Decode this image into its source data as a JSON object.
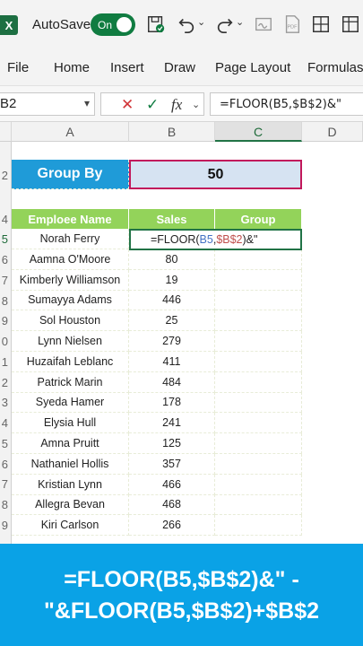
{
  "titlebar": {
    "app_icon": "X",
    "autosave_label": "AutoSave",
    "toggle_label": "On",
    "icons": [
      "save-icon",
      "undo-icon",
      "redo-icon",
      "sign-icon",
      "pdf-icon",
      "grid-icon",
      "table-icon"
    ]
  },
  "ribbon": {
    "tabs": [
      "File",
      "Home",
      "Insert",
      "Draw",
      "Page Layout",
      "Formulas"
    ]
  },
  "formula_bar": {
    "name_box": "B2",
    "cancel_icon": "✕",
    "enter_icon": "✓",
    "fx_label": "fx",
    "formula": "=FLOOR(B5,$B$2)&\""
  },
  "grid": {
    "columns": [
      "A",
      "B",
      "C",
      "D"
    ],
    "row_numbers": [
      "2",
      "4",
      "5",
      "6",
      "7",
      "8",
      "9",
      "0",
      "1",
      "2",
      "3",
      "4",
      "5",
      "6",
      "7",
      "8",
      "9"
    ],
    "group_by_label": "Group By",
    "group_by_value": "50",
    "headers": {
      "name": "Emploee Name",
      "sales": "Sales",
      "group": "Group"
    },
    "edit_formula": {
      "prefix": "=FLOOR(",
      "ref1": "B5",
      "sep": ",",
      "ref2": "$B$2",
      "suffix": ")&\""
    },
    "rows": [
      {
        "name": "Norah Ferry",
        "sales": ""
      },
      {
        "name": "Aamna O'Moore",
        "sales": "80"
      },
      {
        "name": "Kimberly Williamson",
        "sales": "19"
      },
      {
        "name": "Sumayya Adams",
        "sales": "446"
      },
      {
        "name": "Sol Houston",
        "sales": "25"
      },
      {
        "name": "Lynn Nielsen",
        "sales": "279"
      },
      {
        "name": "Huzaifah Leblanc",
        "sales": "411"
      },
      {
        "name": "Patrick Marin",
        "sales": "484"
      },
      {
        "name": "Syeda Hamer",
        "sales": "178"
      },
      {
        "name": "Elysia Hull",
        "sales": "241"
      },
      {
        "name": "Amna Pruitt",
        "sales": "125"
      },
      {
        "name": "Nathaniel Hollis",
        "sales": "357"
      },
      {
        "name": "Kristian Lynn",
        "sales": "466"
      },
      {
        "name": "Allegra Bevan",
        "sales": "468"
      },
      {
        "name": "Kiri Carlson",
        "sales": "266"
      }
    ]
  },
  "banner": {
    "line1": "=FLOOR(B5,$B$2)&\" -",
    "line2": "\"&FLOOR(B5,$B$2)+$B$2"
  },
  "colors": {
    "excel_green": "#107c41",
    "group_by_blue": "#1f9bd8",
    "header_green": "#93d35a",
    "banner_blue": "#0aa2e6",
    "selection_border": "#c2185b"
  }
}
